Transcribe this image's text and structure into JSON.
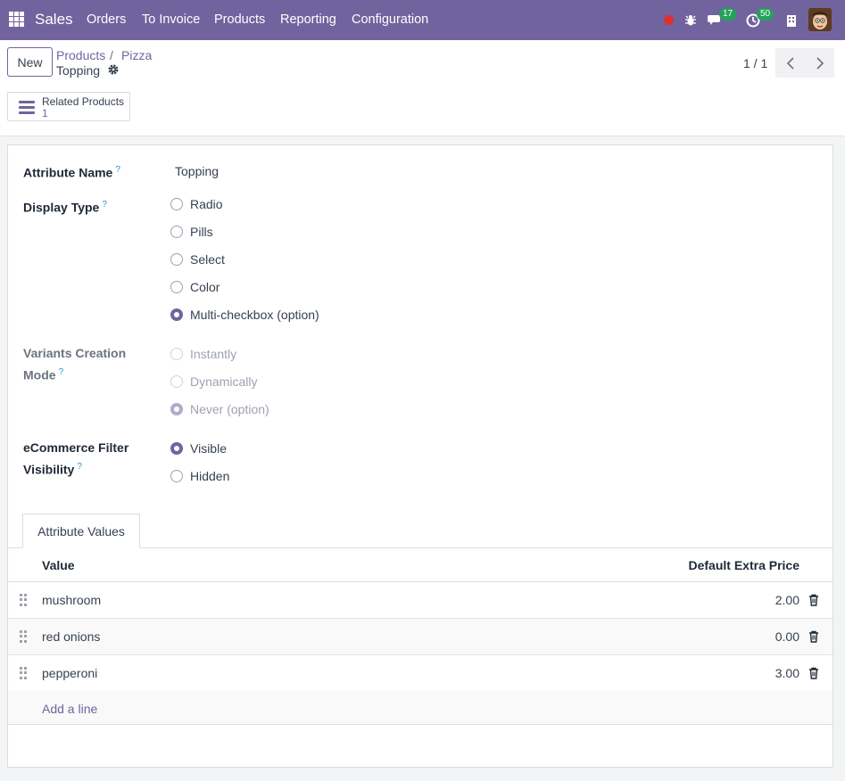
{
  "navbar": {
    "brand": "Sales",
    "menu": [
      "Orders",
      "To Invoice",
      "Products",
      "Reporting",
      "Configuration"
    ],
    "messages_count": "17",
    "activities_count": "50"
  },
  "control": {
    "new_label": "New",
    "breadcrumb": [
      "Products",
      "Pizza"
    ],
    "breadcrumb_sep": "/",
    "current": "Topping",
    "pager": "1 / 1",
    "smart_button": {
      "label": "Related Products",
      "count": "1"
    }
  },
  "form": {
    "attribute_name_label": "Attribute Name",
    "attribute_name_value": "Topping",
    "display_type_label": "Display Type",
    "display_type_options": [
      "Radio",
      "Pills",
      "Select",
      "Color",
      "Multi-checkbox (option)"
    ],
    "display_type_selected": "Multi-checkbox (option)",
    "variants_label_1": "Variants Creation",
    "variants_label_2": "Mode",
    "variants_options": [
      "Instantly",
      "Dynamically",
      "Never (option)"
    ],
    "variants_selected": "Never (option)",
    "ecommerce_label_1": "eCommerce Filter",
    "ecommerce_label_2": "Visibility",
    "ecommerce_options": [
      "Visible",
      "Hidden"
    ],
    "ecommerce_selected": "Visible",
    "help_mark": "?"
  },
  "notebook": {
    "tab_label": "Attribute Values",
    "columns": {
      "value": "Value",
      "price": "Default Extra Price"
    },
    "rows": [
      {
        "value": "mushroom",
        "price": "2.00"
      },
      {
        "value": "red onions",
        "price": "0.00"
      },
      {
        "value": "pepperoni",
        "price": "3.00"
      }
    ],
    "add_line": "Add a line"
  },
  "colors": {
    "brand": "#71639e",
    "badge": "#22a35a",
    "record": "#e02f2f",
    "help": "#1d9bd1"
  }
}
